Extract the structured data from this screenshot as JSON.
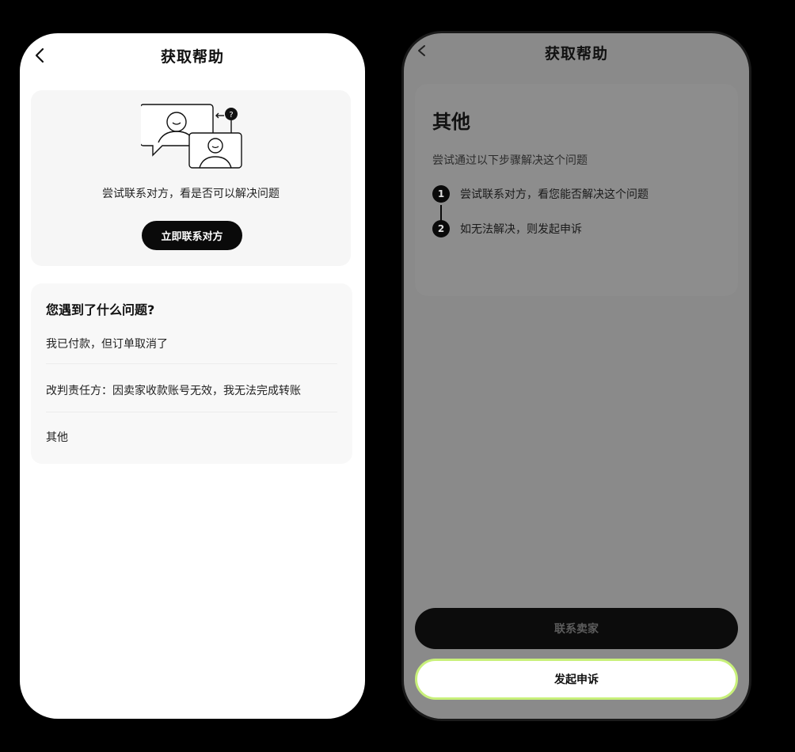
{
  "left": {
    "nav_title": "获取帮助",
    "contact_text": "尝试联系对方，看是否可以解决问题",
    "contact_button": "立即联系对方",
    "issues_title": "您遇到了什么问题?",
    "issues": [
      "我已付款，但订单取消了",
      "改判责任方：因卖家收款账号无效，我无法完成转账",
      "其他"
    ]
  },
  "right": {
    "nav_title": "获取帮助",
    "heading": "其他",
    "subtitle": "尝试通过以下步骤解决这个问题",
    "steps": [
      {
        "num": "1",
        "text": "尝试联系对方，看您能否解决这个问题"
      },
      {
        "num": "2",
        "text": "如无法解决，则发起申诉"
      }
    ],
    "contact_seller_button": "联系卖家",
    "appeal_button": "发起申诉"
  },
  "colors": {
    "accent": "#c8f07a",
    "overlay_gray": "#8a8a8a",
    "dark_button": "#0a0a0a"
  }
}
